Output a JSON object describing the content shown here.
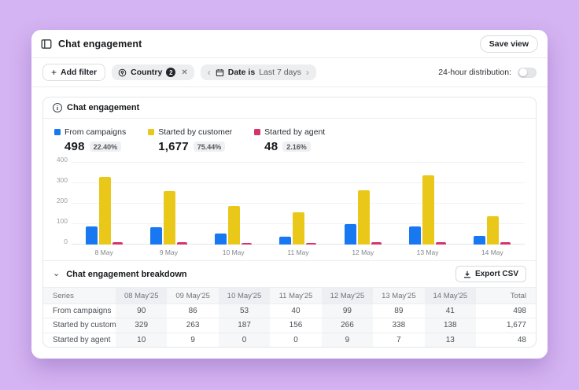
{
  "window": {
    "title": "Chat engagement",
    "save_view_label": "Save view"
  },
  "filter_bar": {
    "add_filter_label": "Add filter",
    "country_filter": {
      "label": "Country",
      "count": "2"
    },
    "date_filter": {
      "prefix": "Date is",
      "value": "Last 7 days"
    },
    "distribution_label": "24-hour distribution:",
    "toggle_state": "off"
  },
  "icons": {
    "plus": "+",
    "close": "✕",
    "chevron_left": "‹",
    "chevron_right": "›",
    "chevron_down": "⌄",
    "info": "i"
  },
  "chart_card": {
    "title": "Chat engagement",
    "legend": [
      {
        "label": "From campaigns",
        "value": "498",
        "percent": "22.40%",
        "color": "#1778f2"
      },
      {
        "label": "Started by customer",
        "value": "1,677",
        "percent": "75.44%",
        "color": "#eac819"
      },
      {
        "label": "Started by agent",
        "value": "48",
        "percent": "2.16%",
        "color": "#d6336c"
      }
    ]
  },
  "chart_data": {
    "type": "bar",
    "title": "Chat engagement",
    "categories": [
      "8 May",
      "9 May",
      "10 May",
      "11 May",
      "12 May",
      "13 May",
      "14 May"
    ],
    "series": [
      {
        "name": "From campaigns",
        "color": "#1778f2",
        "values": [
          90,
          86,
          53,
          40,
          99,
          89,
          41
        ]
      },
      {
        "name": "Started by customer",
        "color": "#eac819",
        "values": [
          329,
          263,
          187,
          156,
          266,
          338,
          138
        ]
      },
      {
        "name": "Started by agent",
        "color": "#d6336c",
        "values": [
          10,
          9,
          0,
          0,
          9,
          7,
          13
        ]
      }
    ],
    "ylim": [
      0,
      400
    ],
    "yticks": [
      0,
      100,
      200,
      300,
      400
    ],
    "grid": true,
    "legend_position": "top"
  },
  "breakdown": {
    "title": "Chat engagement breakdown",
    "export_label": "Export CSV",
    "table": {
      "columns": [
        "Series",
        "08 May'25",
        "09 May'25",
        "10 May'25",
        "11 May'25",
        "12 May'25",
        "13 May'25",
        "14 May'25",
        "Total"
      ],
      "rows": [
        {
          "series": "From campaigns",
          "values": [
            "90",
            "86",
            "53",
            "40",
            "99",
            "89",
            "41"
          ],
          "total": "498"
        },
        {
          "series": "Started by customer",
          "values": [
            "329",
            "263",
            "187",
            "156",
            "266",
            "338",
            "138"
          ],
          "total": "1,677"
        },
        {
          "series": "Started by agent",
          "values": [
            "10",
            "9",
            "0",
            "0",
            "9",
            "7",
            "13"
          ],
          "total": "48"
        }
      ]
    }
  }
}
